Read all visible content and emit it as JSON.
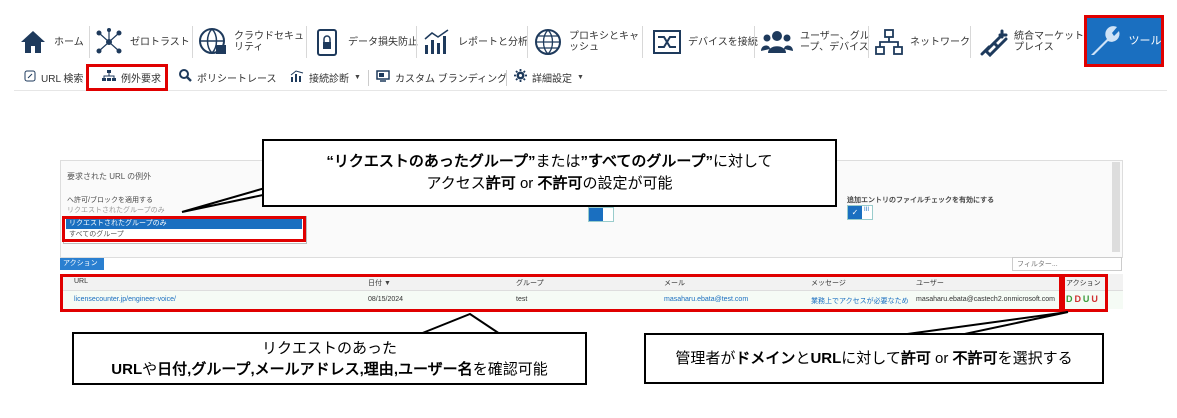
{
  "nav": {
    "items": [
      {
        "label": "ホーム",
        "icon": "home-icon"
      },
      {
        "label": "ゼロトラスト",
        "icon": "zero-trust-icon"
      },
      {
        "label": "クラウドセキュ\nリティ",
        "icon": "cloud-security-icon"
      },
      {
        "label": "データ損失防止",
        "icon": "dlp-icon"
      },
      {
        "label": "レポートと分析",
        "icon": "report-icon"
      },
      {
        "label": "プロキシとキャ\nッシュ",
        "icon": "proxy-icon"
      },
      {
        "label": "デバイスを接続",
        "icon": "device-connect-icon"
      },
      {
        "label": "ユーザー、グル\nープ、デバイス",
        "icon": "users-icon"
      },
      {
        "label": "ネットワーク",
        "icon": "network-icon"
      },
      {
        "label": "統合マーケット\nプレイス",
        "icon": "plugin-icon"
      },
      {
        "label": "ツール",
        "icon": "wrench-icon"
      }
    ]
  },
  "subnav": {
    "url_lookup": "URL 検索",
    "exception": "例外要求",
    "policy_trace": "ポリシートレース",
    "connection_diag": "接続診断",
    "custom_branding": "カスタム ブランディング",
    "advanced": "詳細設定"
  },
  "panel": {
    "title": "要求された URL の例外",
    "allow_block_label": "へ許可/ブロックを適用する",
    "select_value": "リクエストされたグループのみ",
    "options": [
      "リクエストされたグループのみ",
      "すべてのグループ"
    ],
    "file_check_label": "追加エントリのファイルチェックを有効にする",
    "toggle_text": "III"
  },
  "action_button": "アクション",
  "filter_placeholder": "フィルター...",
  "table": {
    "headers": [
      "URL",
      "日付",
      "グループ",
      "メール",
      "メッセージ",
      "ユーザー",
      "アクション"
    ],
    "row": {
      "url": "licensecounter.jp/engineer-voice/",
      "date": "08/15/2024",
      "group": "test",
      "email": "masaharu.ebata@test.com",
      "message": "業務上でアクセスが必要なため",
      "user": "masaharu.ebata@castech2.onmicrosoft.com",
      "actions": [
        "D",
        "D",
        "U",
        "U"
      ]
    }
  },
  "callouts": {
    "c1_l1_a": "“リクエストのあったグループ”",
    "c1_l1_b": "または",
    "c1_l1_c": "”すべてのグループ”",
    "c1_l1_d": "に対して",
    "c1_l2_a": "アクセス",
    "c1_l2_b": "許可",
    "c1_l2_c": " or ",
    "c1_l2_d": "不許可",
    "c1_l2_e": "の設定が可能",
    "c2_l1": "リクエストのあった",
    "c2_l2_a": "URL",
    "c2_l2_b": "や",
    "c2_l2_c": "日付",
    "c2_l2_d": ",",
    "c2_l2_e": "グループ",
    "c2_l2_f": ",",
    "c2_l2_g": "メールアドレス",
    "c2_l2_h": ",",
    "c2_l2_i": "理由",
    "c2_l2_j": ",",
    "c2_l2_k": "ユーザー名",
    "c2_l2_l": "を確認可能",
    "c3_a": "管理者が",
    "c3_b": "ドメイン",
    "c3_c": "と",
    "c3_d": "URL",
    "c3_e": "に対して",
    "c3_f": "許可",
    "c3_g": " or ",
    "c3_h": "不許可",
    "c3_i": "を選択する"
  },
  "colors": {
    "accent": "#1a6fc0",
    "highlight": "#e00000",
    "link": "#1a6fc0",
    "action_green": "#3a9a3a",
    "action_red": "#d03030"
  }
}
